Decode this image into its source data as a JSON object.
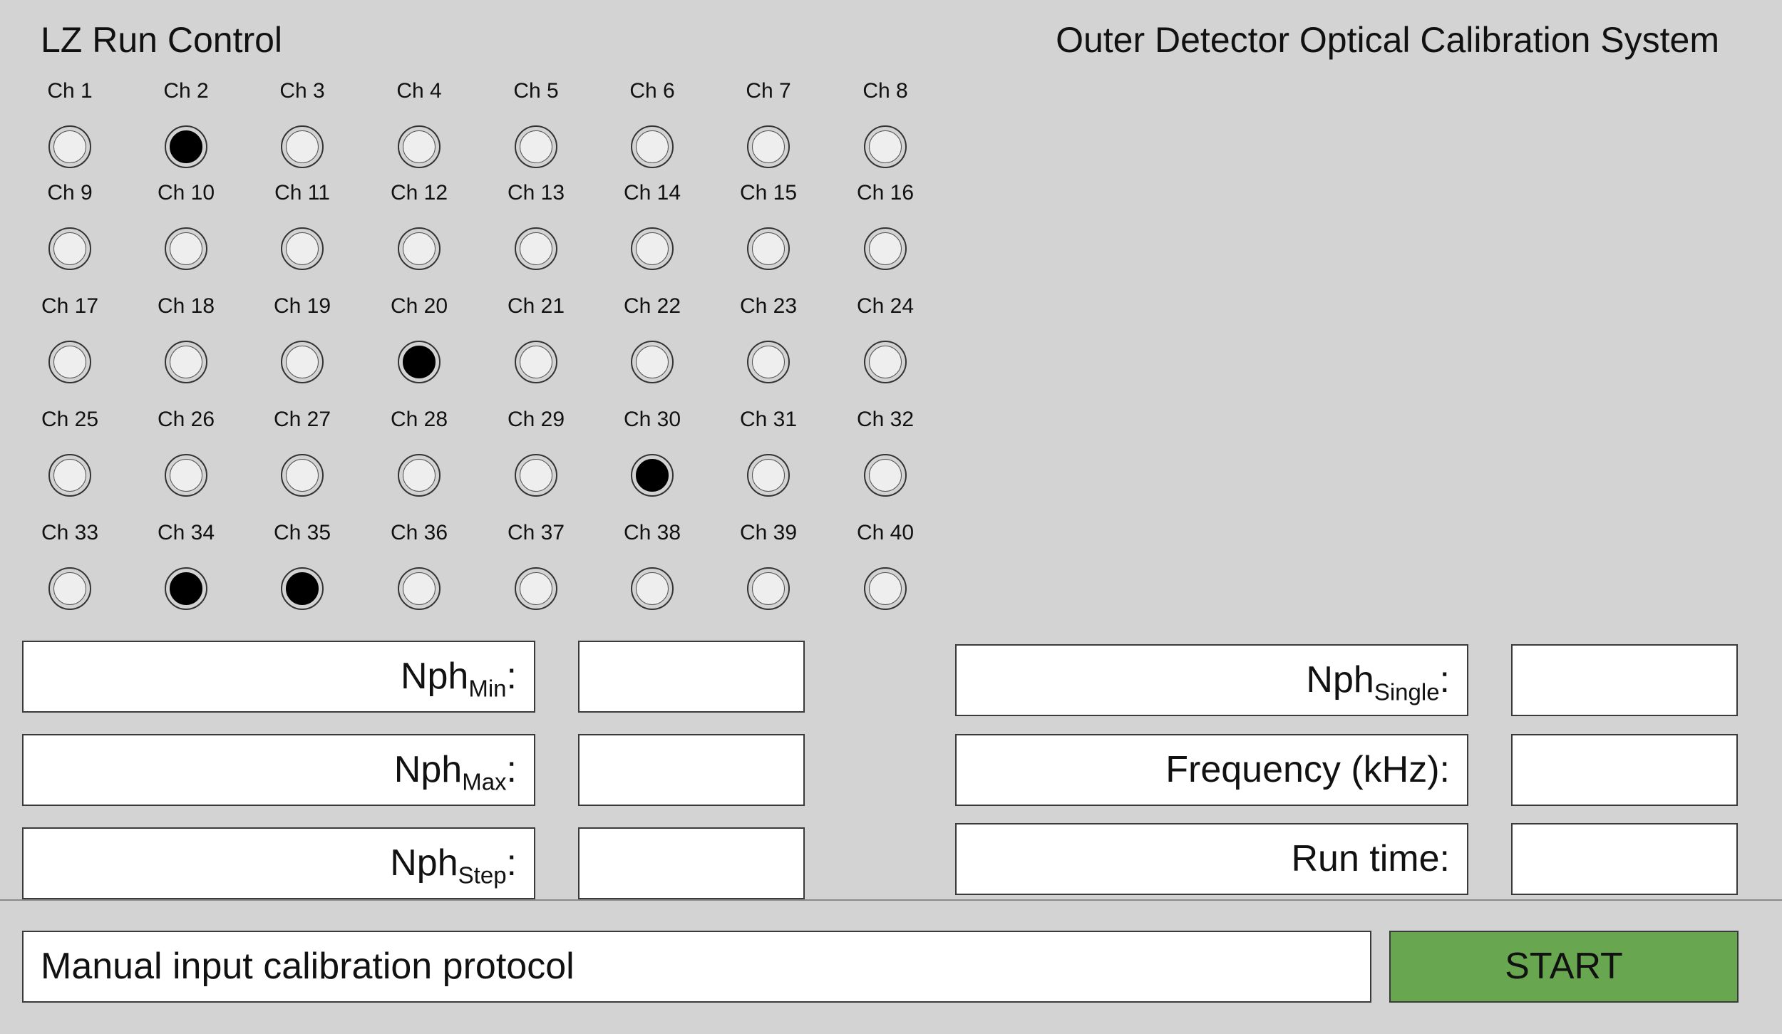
{
  "app_title": "LZ Run Control",
  "system_title": "Outer Detector Optical Calibration System",
  "channels": [
    {
      "label": "Ch 1",
      "selected": false
    },
    {
      "label": "Ch 2",
      "selected": true
    },
    {
      "label": "Ch 3",
      "selected": false
    },
    {
      "label": "Ch 4",
      "selected": false
    },
    {
      "label": "Ch 5",
      "selected": false
    },
    {
      "label": "Ch 6",
      "selected": false
    },
    {
      "label": "Ch 7",
      "selected": false
    },
    {
      "label": "Ch 8",
      "selected": false
    },
    {
      "label": "Ch 9",
      "selected": false
    },
    {
      "label": "Ch 10",
      "selected": false
    },
    {
      "label": "Ch 11",
      "selected": false
    },
    {
      "label": "Ch 12",
      "selected": false
    },
    {
      "label": "Ch 13",
      "selected": false
    },
    {
      "label": "Ch 14",
      "selected": false
    },
    {
      "label": "Ch 15",
      "selected": false
    },
    {
      "label": "Ch 16",
      "selected": false
    },
    {
      "label": "Ch 17",
      "selected": false
    },
    {
      "label": "Ch 18",
      "selected": false
    },
    {
      "label": "Ch 19",
      "selected": false
    },
    {
      "label": "Ch 20",
      "selected": true
    },
    {
      "label": "Ch 21",
      "selected": false
    },
    {
      "label": "Ch 22",
      "selected": false
    },
    {
      "label": "Ch 23",
      "selected": false
    },
    {
      "label": "Ch 24",
      "selected": false
    },
    {
      "label": "Ch 25",
      "selected": false
    },
    {
      "label": "Ch 26",
      "selected": false
    },
    {
      "label": "Ch 27",
      "selected": false
    },
    {
      "label": "Ch 28",
      "selected": false
    },
    {
      "label": "Ch 29",
      "selected": false
    },
    {
      "label": "Ch 30",
      "selected": true
    },
    {
      "label": "Ch 31",
      "selected": false
    },
    {
      "label": "Ch 32",
      "selected": false
    },
    {
      "label": "Ch 33",
      "selected": false
    },
    {
      "label": "Ch 34",
      "selected": true
    },
    {
      "label": "Ch 35",
      "selected": true
    },
    {
      "label": "Ch 36",
      "selected": false
    },
    {
      "label": "Ch 37",
      "selected": false
    },
    {
      "label": "Ch 38",
      "selected": false
    },
    {
      "label": "Ch 39",
      "selected": false
    },
    {
      "label": "Ch 40",
      "selected": false
    }
  ],
  "fields": {
    "nph_min": {
      "label": "Nph",
      "sub": "Min",
      "suffix": ":",
      "value": ""
    },
    "nph_max": {
      "label": "Nph",
      "sub": "Max",
      "suffix": ":",
      "value": ""
    },
    "nph_step": {
      "label": "Nph",
      "sub": "Step",
      "suffix": ":",
      "value": ""
    },
    "nph_single": {
      "label": "Nph",
      "sub": "Single",
      "suffix": ":",
      "value": ""
    },
    "frequency": {
      "label": "Frequency (kHz):",
      "value": ""
    },
    "run_time": {
      "label": "Run time:",
      "value": ""
    }
  },
  "protocol": {
    "label": "Manual input calibration protocol"
  },
  "start_button": {
    "label": "START"
  },
  "colors": {
    "background": "#d3d3d3",
    "start_button": "#68a750",
    "radio_selected": "#000000",
    "radio_unselected": "#eeeeee"
  }
}
